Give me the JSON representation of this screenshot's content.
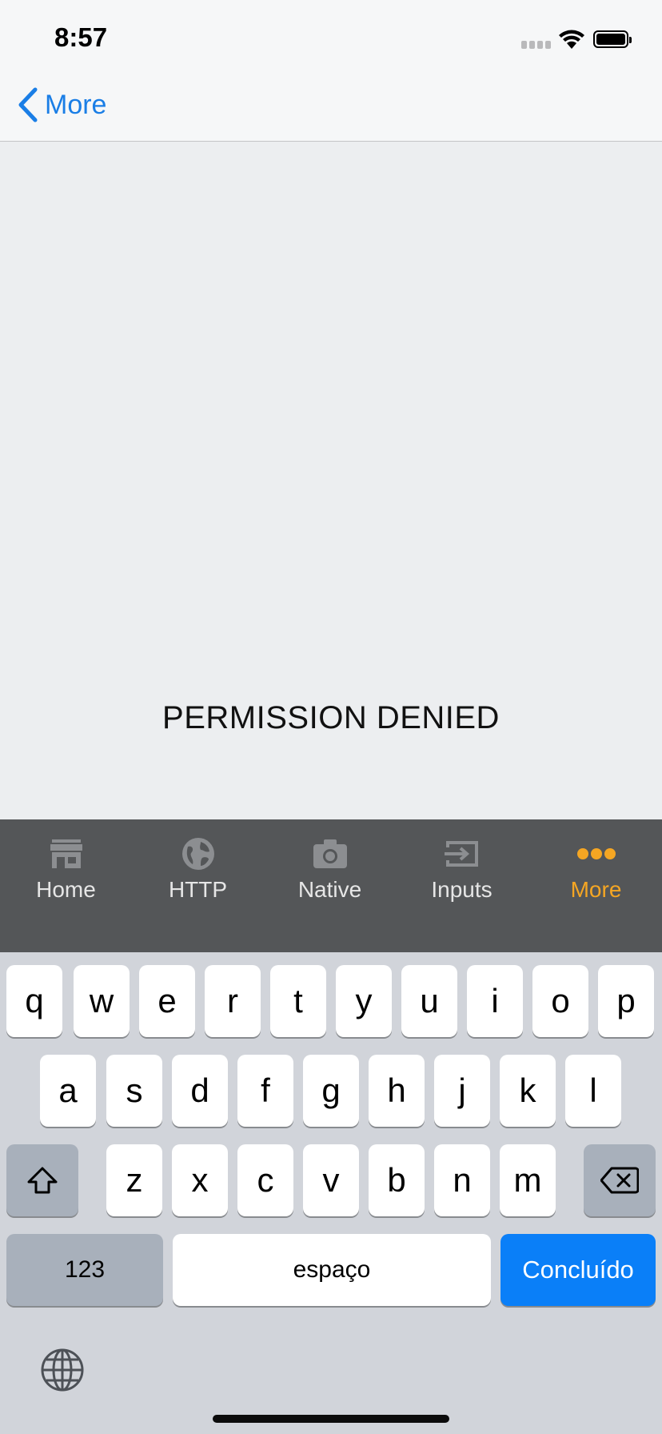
{
  "status_bar": {
    "time": "8:57"
  },
  "nav_bar": {
    "back_label": "More"
  },
  "content": {
    "message": "PERMISSION DENIED"
  },
  "tabs": [
    {
      "label": "Home",
      "icon": "store-icon",
      "active": false
    },
    {
      "label": "HTTP",
      "icon": "globe-icon",
      "active": false
    },
    {
      "label": "Native",
      "icon": "camera-icon",
      "active": false
    },
    {
      "label": "Inputs",
      "icon": "input-icon",
      "active": false
    },
    {
      "label": "More",
      "icon": "more-dots-icon",
      "active": true
    }
  ],
  "colors": {
    "accent": "#1a7ee6",
    "tab_active": "#f5a623",
    "tab_bar_bg": "#545658",
    "done_key": "#0a7ff8"
  },
  "keyboard": {
    "row1": [
      "q",
      "w",
      "e",
      "r",
      "t",
      "y",
      "u",
      "i",
      "o",
      "p"
    ],
    "row2": [
      "a",
      "s",
      "d",
      "f",
      "g",
      "h",
      "j",
      "k",
      "l"
    ],
    "row3": [
      "z",
      "x",
      "c",
      "v",
      "b",
      "n",
      "m"
    ],
    "numbers_key": "123",
    "space_key": "espaço",
    "done_key": "Concluído",
    "shift_icon": "shift-icon",
    "delete_icon": "delete-icon",
    "globe_icon": "globe-icon"
  }
}
